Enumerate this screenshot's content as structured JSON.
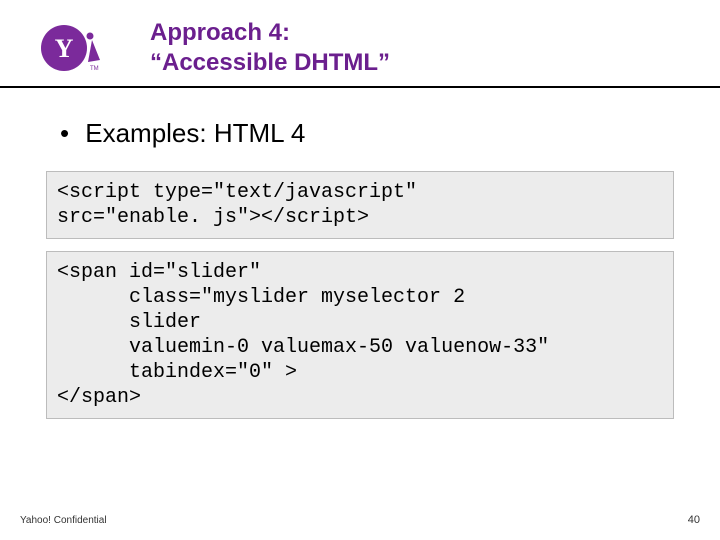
{
  "header": {
    "title_line1": "Approach 4:",
    "title_line2": "“Accessible DHTML”"
  },
  "bullet": {
    "label": "Examples: HTML 4"
  },
  "code1": "<script type=\"text/javascript\"\nsrc=\"enable. js\"></script>",
  "code2": "<span id=\"slider\"\n      class=\"myslider myselector 2\n      slider\n      valuemin-0 valuemax-50 valuenow-33\"\n      tabindex=\"0\" >\n</span>",
  "footer": {
    "left": "Yahoo! Confidential",
    "right": "40"
  }
}
